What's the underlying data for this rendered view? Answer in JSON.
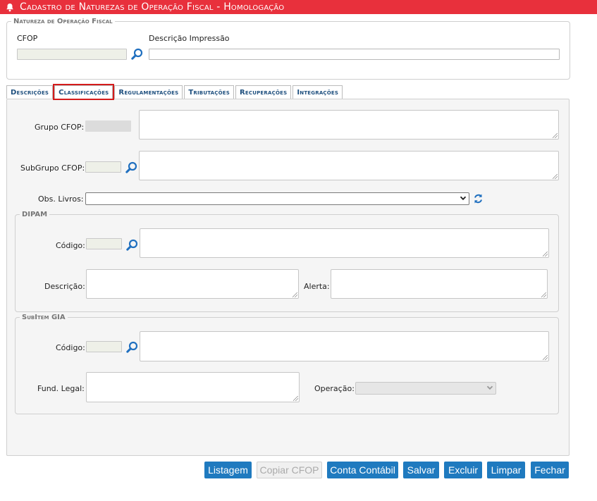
{
  "window": {
    "title": "Cadastro de Naturezas de Operação Fiscal  - Homologação"
  },
  "natureza": {
    "legend": "Natureza de Operação Fiscal",
    "cfop_label": "CFOP",
    "cfop_value": "",
    "descricao_label": "Descrição Impressão",
    "descricao_value": ""
  },
  "tabs": [
    {
      "label": "Descrições",
      "active": false
    },
    {
      "label": "Classificações",
      "active": true
    },
    {
      "label": "Regulamentações",
      "active": false
    },
    {
      "label": "Tributações",
      "active": false
    },
    {
      "label": "Recuperações",
      "active": false
    },
    {
      "label": "Integrações",
      "active": false
    }
  ],
  "classificacoes": {
    "grupo_cfop_label": "Grupo CFOP:",
    "subgrupo_cfop_label": "SubGrupo CFOP:",
    "obs_livros_label": "Obs. Livros:",
    "obs_livros_value": ""
  },
  "dipam": {
    "legend": "DIPAM",
    "codigo_label": "Código:",
    "descricao_label": "Descrição:",
    "alerta_label": "Alerta:"
  },
  "subitem_gia": {
    "legend": "SubItem GIA",
    "codigo_label": "Código:",
    "fund_legal_label": "Fund. Legal:",
    "operacao_label": "Operação:",
    "operacao_value": ""
  },
  "buttons": {
    "listagem": "Listagem",
    "copiar_cfop": "Copiar CFOP",
    "conta_contabil": "Conta Contábil",
    "salvar": "Salvar",
    "excluir": "Excluir",
    "limpar": "Limpar",
    "fechar": "Fechar"
  },
  "colors": {
    "titlebar": "#e8303c",
    "tab_text": "#1e4f7e",
    "button": "#1f7abf",
    "active_tab_outline": "#d51b1b"
  }
}
